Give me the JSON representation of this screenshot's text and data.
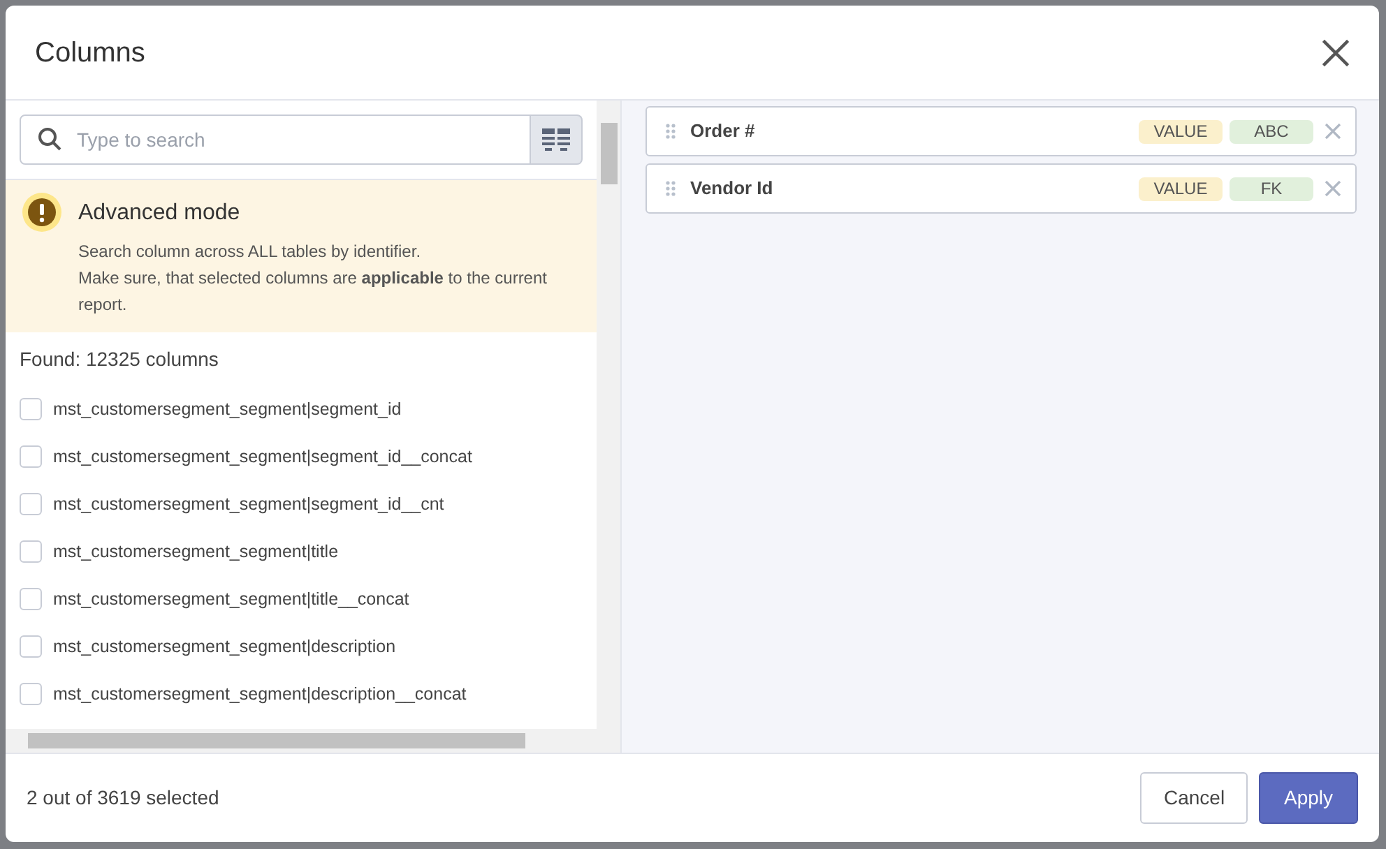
{
  "dialog": {
    "title": "Columns"
  },
  "search": {
    "placeholder": "Type to search"
  },
  "notice": {
    "title": "Advanced mode",
    "lines": [
      "Search column across ALL tables by identifier.",
      "Make sure, that selected columns are **applicable** to the current report."
    ]
  },
  "found": "Found: 12325 columns",
  "columns": [
    {
      "label": "mst_customersegment_segment|segment_id",
      "checked": false
    },
    {
      "label": "mst_customersegment_segment|segment_id__concat",
      "checked": false
    },
    {
      "label": "mst_customersegment_segment|segment_id__cnt",
      "checked": false
    },
    {
      "label": "mst_customersegment_segment|title",
      "checked": false
    },
    {
      "label": "mst_customersegment_segment|title__concat",
      "checked": false
    },
    {
      "label": "mst_customersegment_segment|description",
      "checked": false
    },
    {
      "label": "mst_customersegment_segment|description__concat",
      "checked": false
    }
  ],
  "selected_columns": [
    {
      "name": "Order #",
      "tags": [
        "VALUE",
        "ABC"
      ]
    },
    {
      "name": "Vendor Id",
      "tags": [
        "VALUE",
        "FK"
      ]
    }
  ],
  "footer": {
    "status": "2 out of 3619 selected",
    "buttons": [
      {
        "label": "Cancel",
        "kind": "secondary"
      },
      {
        "label": "Apply",
        "kind": "primary"
      }
    ]
  }
}
